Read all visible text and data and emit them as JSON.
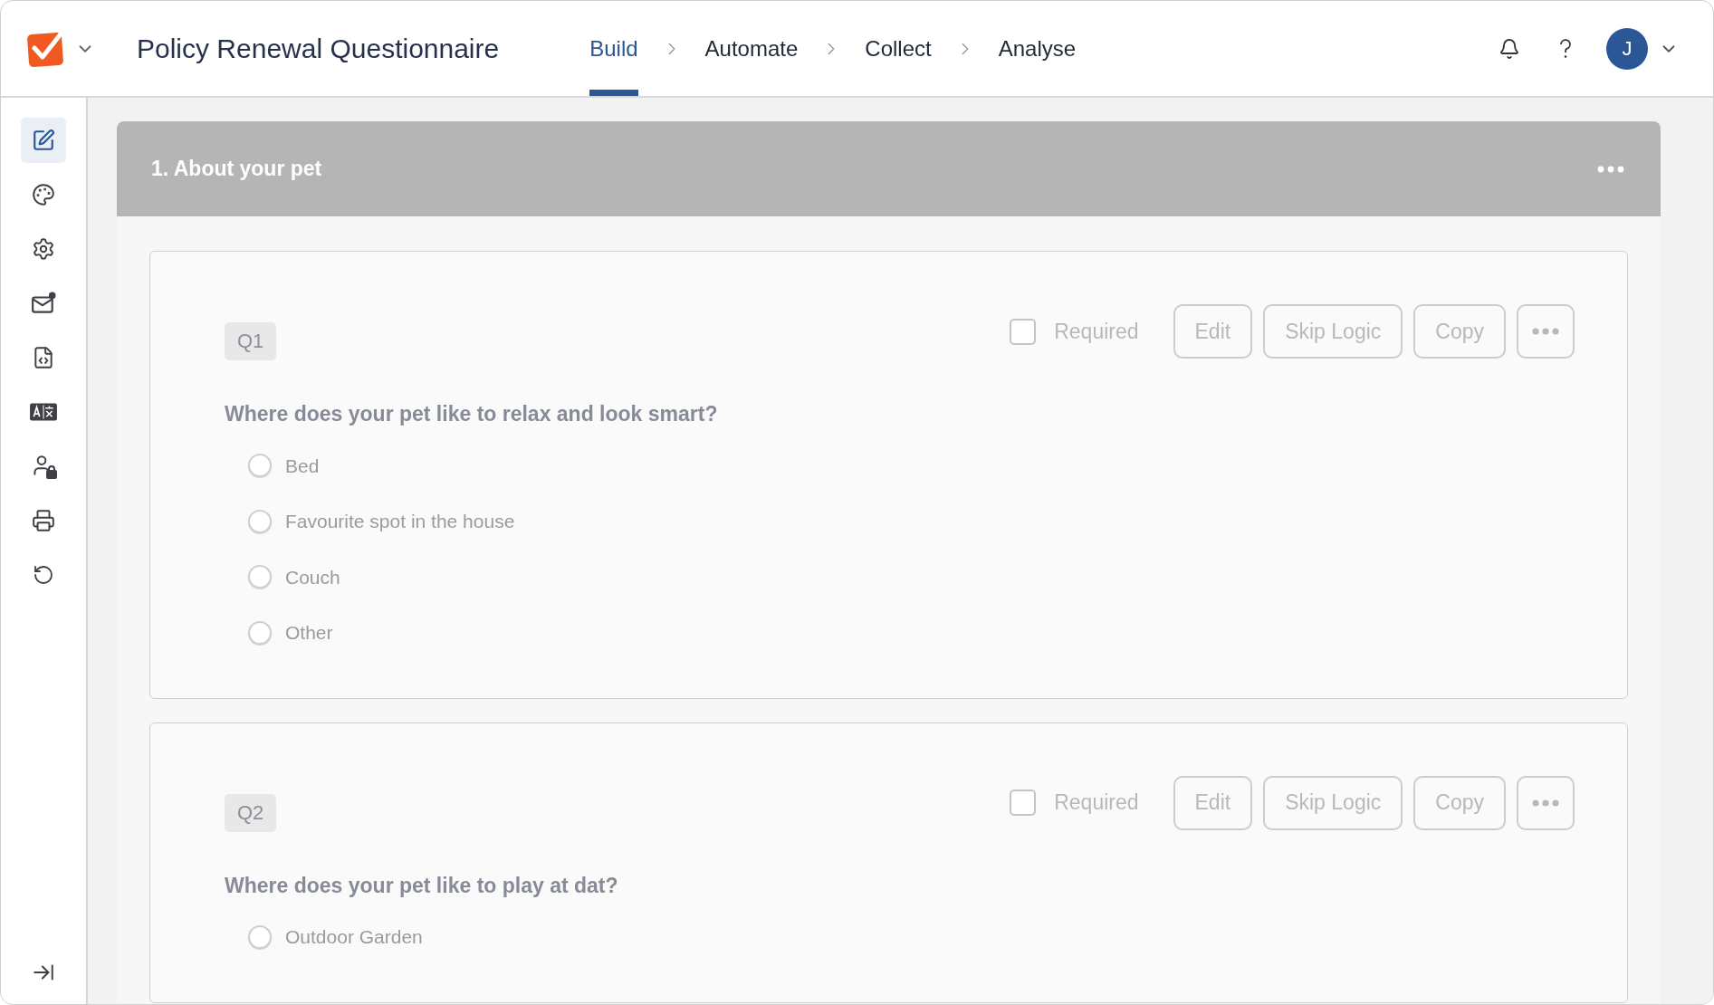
{
  "header": {
    "title": "Policy Renewal Questionnaire",
    "steps": [
      {
        "label": "Build",
        "selected": true
      },
      {
        "label": "Automate",
        "selected": false
      },
      {
        "label": "Collect",
        "selected": false
      },
      {
        "label": "Analyse",
        "selected": false
      }
    ],
    "avatar": "J"
  },
  "sidebar": {
    "items": [
      {
        "kind": "edit",
        "selected": true
      },
      {
        "kind": "palette",
        "selected": false
      },
      {
        "kind": "settings",
        "selected": false
      },
      {
        "kind": "mail",
        "selected": false
      },
      {
        "kind": "code",
        "selected": false
      },
      {
        "kind": "translate",
        "selected": false
      },
      {
        "kind": "access",
        "selected": false
      },
      {
        "kind": "print",
        "selected": false
      },
      {
        "kind": "history",
        "selected": false
      }
    ]
  },
  "section": {
    "title": "1. About your pet"
  },
  "questions": [
    {
      "number": "Q1",
      "required_label": "Required",
      "required": false,
      "buttons": [
        "Edit",
        "Skip Logic",
        "Copy"
      ],
      "text": "Where does your pet like to relax and look smart?",
      "options": [
        {
          "label": "Bed",
          "selected": false
        },
        {
          "label": "Favourite spot in the house",
          "selected": false
        },
        {
          "label": "Couch",
          "selected": false
        },
        {
          "label": "Other",
          "selected": false
        }
      ]
    },
    {
      "number": "Q2",
      "required_label": "Required",
      "required": false,
      "buttons": [
        "Edit",
        "Skip Logic",
        "Copy"
      ],
      "text": "Where does your pet like to play at dat?",
      "options": [
        {
          "label": "Outdoor Garden",
          "selected": false
        }
      ]
    }
  ]
}
